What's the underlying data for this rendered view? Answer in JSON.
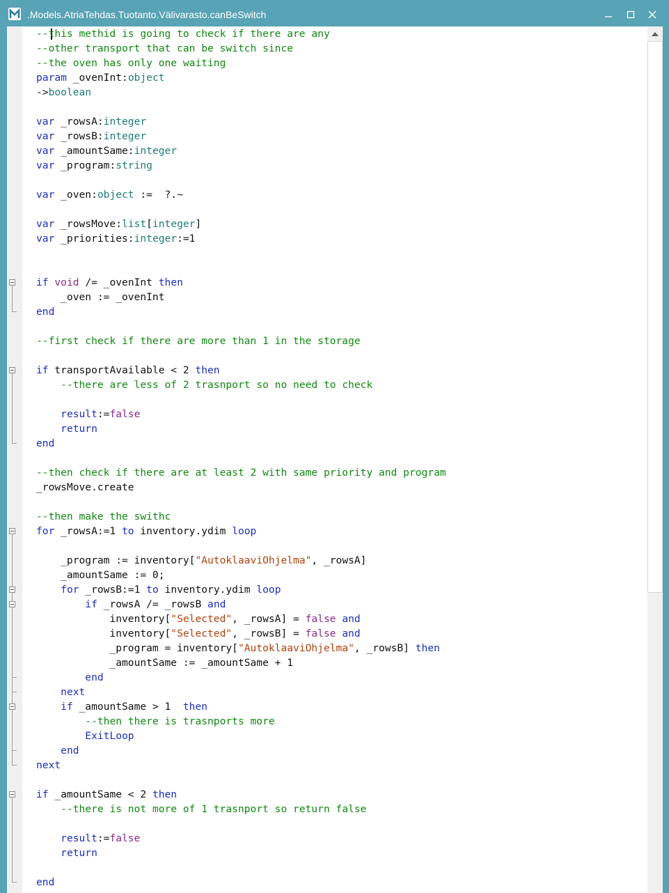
{
  "window": {
    "title": ".Models.AtriaTehdas.Tuotanto.Välivarasto.canBeSwitch",
    "app_icon": "m-logo-icon",
    "controls": [
      "minimize-icon",
      "maximize-icon",
      "close-icon"
    ]
  },
  "colors": {
    "titlebar": "#58a3b5",
    "comment": "#118811",
    "keyword": "#1b2fb8",
    "type": "#1e7a7a",
    "literal": "#8b2a8b",
    "string": "#b0410e",
    "default": "#111111"
  },
  "editor": {
    "lines": [
      [
        [
          "c",
          "--this methid is going to check if there are any"
        ]
      ],
      [
        [
          "c",
          "--other transport that can be switch since"
        ]
      ],
      [
        [
          "c",
          "--the oven has only one waiting"
        ]
      ],
      [
        [
          "k",
          "param"
        ],
        [
          "n",
          " _ovenInt:"
        ],
        [
          "t",
          "object"
        ]
      ],
      [
        [
          "n",
          "->"
        ],
        [
          "t",
          "boolean"
        ]
      ],
      [],
      [
        [
          "k",
          "var"
        ],
        [
          "n",
          " _rowsA:"
        ],
        [
          "t",
          "integer"
        ]
      ],
      [
        [
          "k",
          "var"
        ],
        [
          "n",
          " _rowsB:"
        ],
        [
          "t",
          "integer"
        ]
      ],
      [
        [
          "k",
          "var"
        ],
        [
          "n",
          " _amountSame:"
        ],
        [
          "t",
          "integer"
        ]
      ],
      [
        [
          "k",
          "var"
        ],
        [
          "n",
          " _program:"
        ],
        [
          "t",
          "string"
        ]
      ],
      [],
      [
        [
          "k",
          "var"
        ],
        [
          "n",
          " _oven:"
        ],
        [
          "t",
          "object"
        ],
        [
          "n",
          " :=  ?.~"
        ]
      ],
      [],
      [
        [
          "k",
          "var"
        ],
        [
          "n",
          " _rowsMove:"
        ],
        [
          "t",
          "list"
        ],
        [
          "n",
          "["
        ],
        [
          "t",
          "integer"
        ],
        [
          "n",
          "]"
        ]
      ],
      [
        [
          "k",
          "var"
        ],
        [
          "n",
          " _priorities:"
        ],
        [
          "t",
          "integer"
        ],
        [
          "n",
          ":=1"
        ]
      ],
      [],
      [],
      [
        [
          "k",
          "if"
        ],
        [
          "n",
          " "
        ],
        [
          "l",
          "void"
        ],
        [
          "n",
          " /= _ovenInt "
        ],
        [
          "k",
          "then"
        ]
      ],
      [
        [
          "n",
          "    _oven := _ovenInt"
        ]
      ],
      [
        [
          "k",
          "end"
        ]
      ],
      [],
      [
        [
          "c",
          "--first check if there are more than 1 in the storage"
        ]
      ],
      [],
      [
        [
          "k",
          "if"
        ],
        [
          "n",
          " transportAvailable < 2 "
        ],
        [
          "k",
          "then"
        ]
      ],
      [
        [
          "n",
          "    "
        ],
        [
          "c",
          "--there are less of 2 trasnport so no need to check"
        ]
      ],
      [],
      [
        [
          "n",
          "    "
        ],
        [
          "k",
          "result"
        ],
        [
          "n",
          ":="
        ],
        [
          "l",
          "false"
        ]
      ],
      [
        [
          "n",
          "    "
        ],
        [
          "k",
          "return"
        ]
      ],
      [
        [
          "k",
          "end"
        ]
      ],
      [],
      [
        [
          "c",
          "--then check if there are at least 2 with same priority and program"
        ]
      ],
      [
        [
          "n",
          "_rowsMove.create"
        ]
      ],
      [],
      [
        [
          "c",
          "--then make the swithc"
        ]
      ],
      [
        [
          "k",
          "for"
        ],
        [
          "n",
          " _rowsA:=1 "
        ],
        [
          "k",
          "to"
        ],
        [
          "n",
          " inventory.ydim "
        ],
        [
          "k",
          "loop"
        ]
      ],
      [],
      [
        [
          "n",
          "    _program := inventory["
        ],
        [
          "s",
          "\"AutoklaaviOhjelma\""
        ],
        [
          "n",
          ", _rowsA]"
        ]
      ],
      [
        [
          "n",
          "    _amountSame := 0;"
        ]
      ],
      [
        [
          "n",
          "    "
        ],
        [
          "k",
          "for"
        ],
        [
          "n",
          " _rowsB:=1 "
        ],
        [
          "k",
          "to"
        ],
        [
          "n",
          " inventory.ydim "
        ],
        [
          "k",
          "loop"
        ]
      ],
      [
        [
          "n",
          "        "
        ],
        [
          "k",
          "if"
        ],
        [
          "n",
          " _rowsA /= _rowsB "
        ],
        [
          "k",
          "and"
        ]
      ],
      [
        [
          "n",
          "            inventory["
        ],
        [
          "s",
          "\"Selected\""
        ],
        [
          "n",
          ", _rowsA] = "
        ],
        [
          "l",
          "false"
        ],
        [
          "n",
          " "
        ],
        [
          "k",
          "and"
        ]
      ],
      [
        [
          "n",
          "            inventory["
        ],
        [
          "s",
          "\"Selected\""
        ],
        [
          "n",
          ", _rowsB] = "
        ],
        [
          "l",
          "false"
        ],
        [
          "n",
          " "
        ],
        [
          "k",
          "and"
        ]
      ],
      [
        [
          "n",
          "            _program = inventory["
        ],
        [
          "s",
          "\"AutoklaaviOhjelma\""
        ],
        [
          "n",
          ", _rowsB] "
        ],
        [
          "k",
          "then"
        ]
      ],
      [
        [
          "n",
          "            _amountSame := _amountSame + 1"
        ]
      ],
      [
        [
          "n",
          "        "
        ],
        [
          "k",
          "end"
        ]
      ],
      [
        [
          "n",
          "    "
        ],
        [
          "k",
          "next"
        ]
      ],
      [
        [
          "n",
          "    "
        ],
        [
          "k",
          "if"
        ],
        [
          "n",
          " _amountSame > 1  "
        ],
        [
          "k",
          "then"
        ]
      ],
      [
        [
          "n",
          "        "
        ],
        [
          "c",
          "--then there is trasnports more"
        ]
      ],
      [
        [
          "n",
          "        "
        ],
        [
          "k",
          "ExitLoop"
        ]
      ],
      [
        [
          "n",
          "    "
        ],
        [
          "k",
          "end"
        ]
      ],
      [
        [
          "k",
          "next"
        ]
      ],
      [],
      [
        [
          "k",
          "if"
        ],
        [
          "n",
          " _amountSame < 2 "
        ],
        [
          "k",
          "then"
        ]
      ],
      [
        [
          "n",
          "    "
        ],
        [
          "c",
          "--there is not more of 1 trasnport so return false"
        ]
      ],
      [],
      [
        [
          "n",
          "    "
        ],
        [
          "k",
          "result"
        ],
        [
          "n",
          ":="
        ],
        [
          "l",
          "false"
        ]
      ],
      [
        [
          "n",
          "    "
        ],
        [
          "k",
          "return"
        ]
      ],
      [],
      [
        [
          "k",
          "end"
        ]
      ]
    ]
  }
}
